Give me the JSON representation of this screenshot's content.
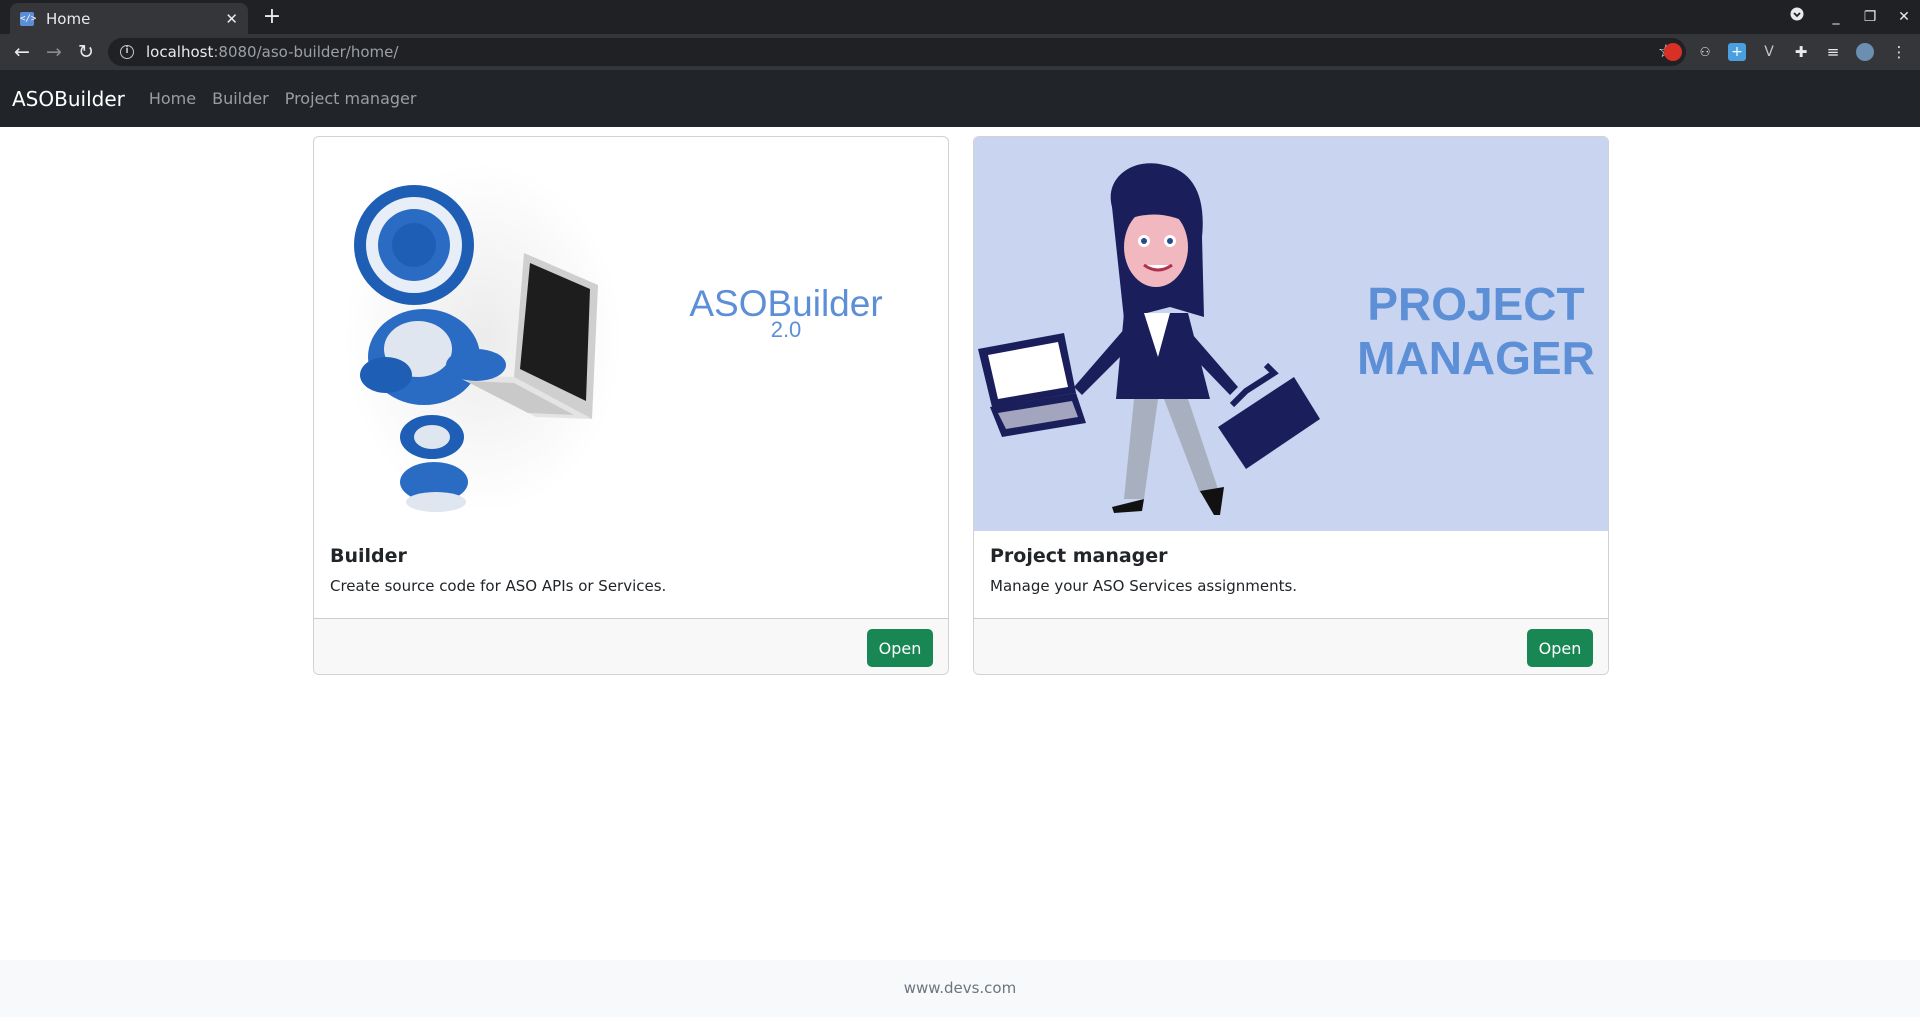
{
  "browser": {
    "tab_title": "Home",
    "url_host": "localhost",
    "url_rest": ":8080/aso-builder/home/"
  },
  "navbar": {
    "brand": "ASOBuilder",
    "links": [
      "Home",
      "Builder",
      "Project manager"
    ]
  },
  "cards": [
    {
      "image_title": "ASOBuilder",
      "image_subtitle": "2.0",
      "title": "Builder",
      "text": "Create source code for ASO APIs or Services.",
      "button": "Open"
    },
    {
      "image_title_line1": "PROJECT",
      "image_title_line2": "MANAGER",
      "title": "Project manager",
      "text": "Manage your ASO Services assignments.",
      "button": "Open"
    }
  ],
  "footer": {
    "text": "www.devs.com"
  },
  "colors": {
    "navbar_bg": "#212529",
    "button_green": "#198754",
    "pm_image_bg": "#c8d4f0",
    "image_text_blue": "#5d8fd6"
  }
}
